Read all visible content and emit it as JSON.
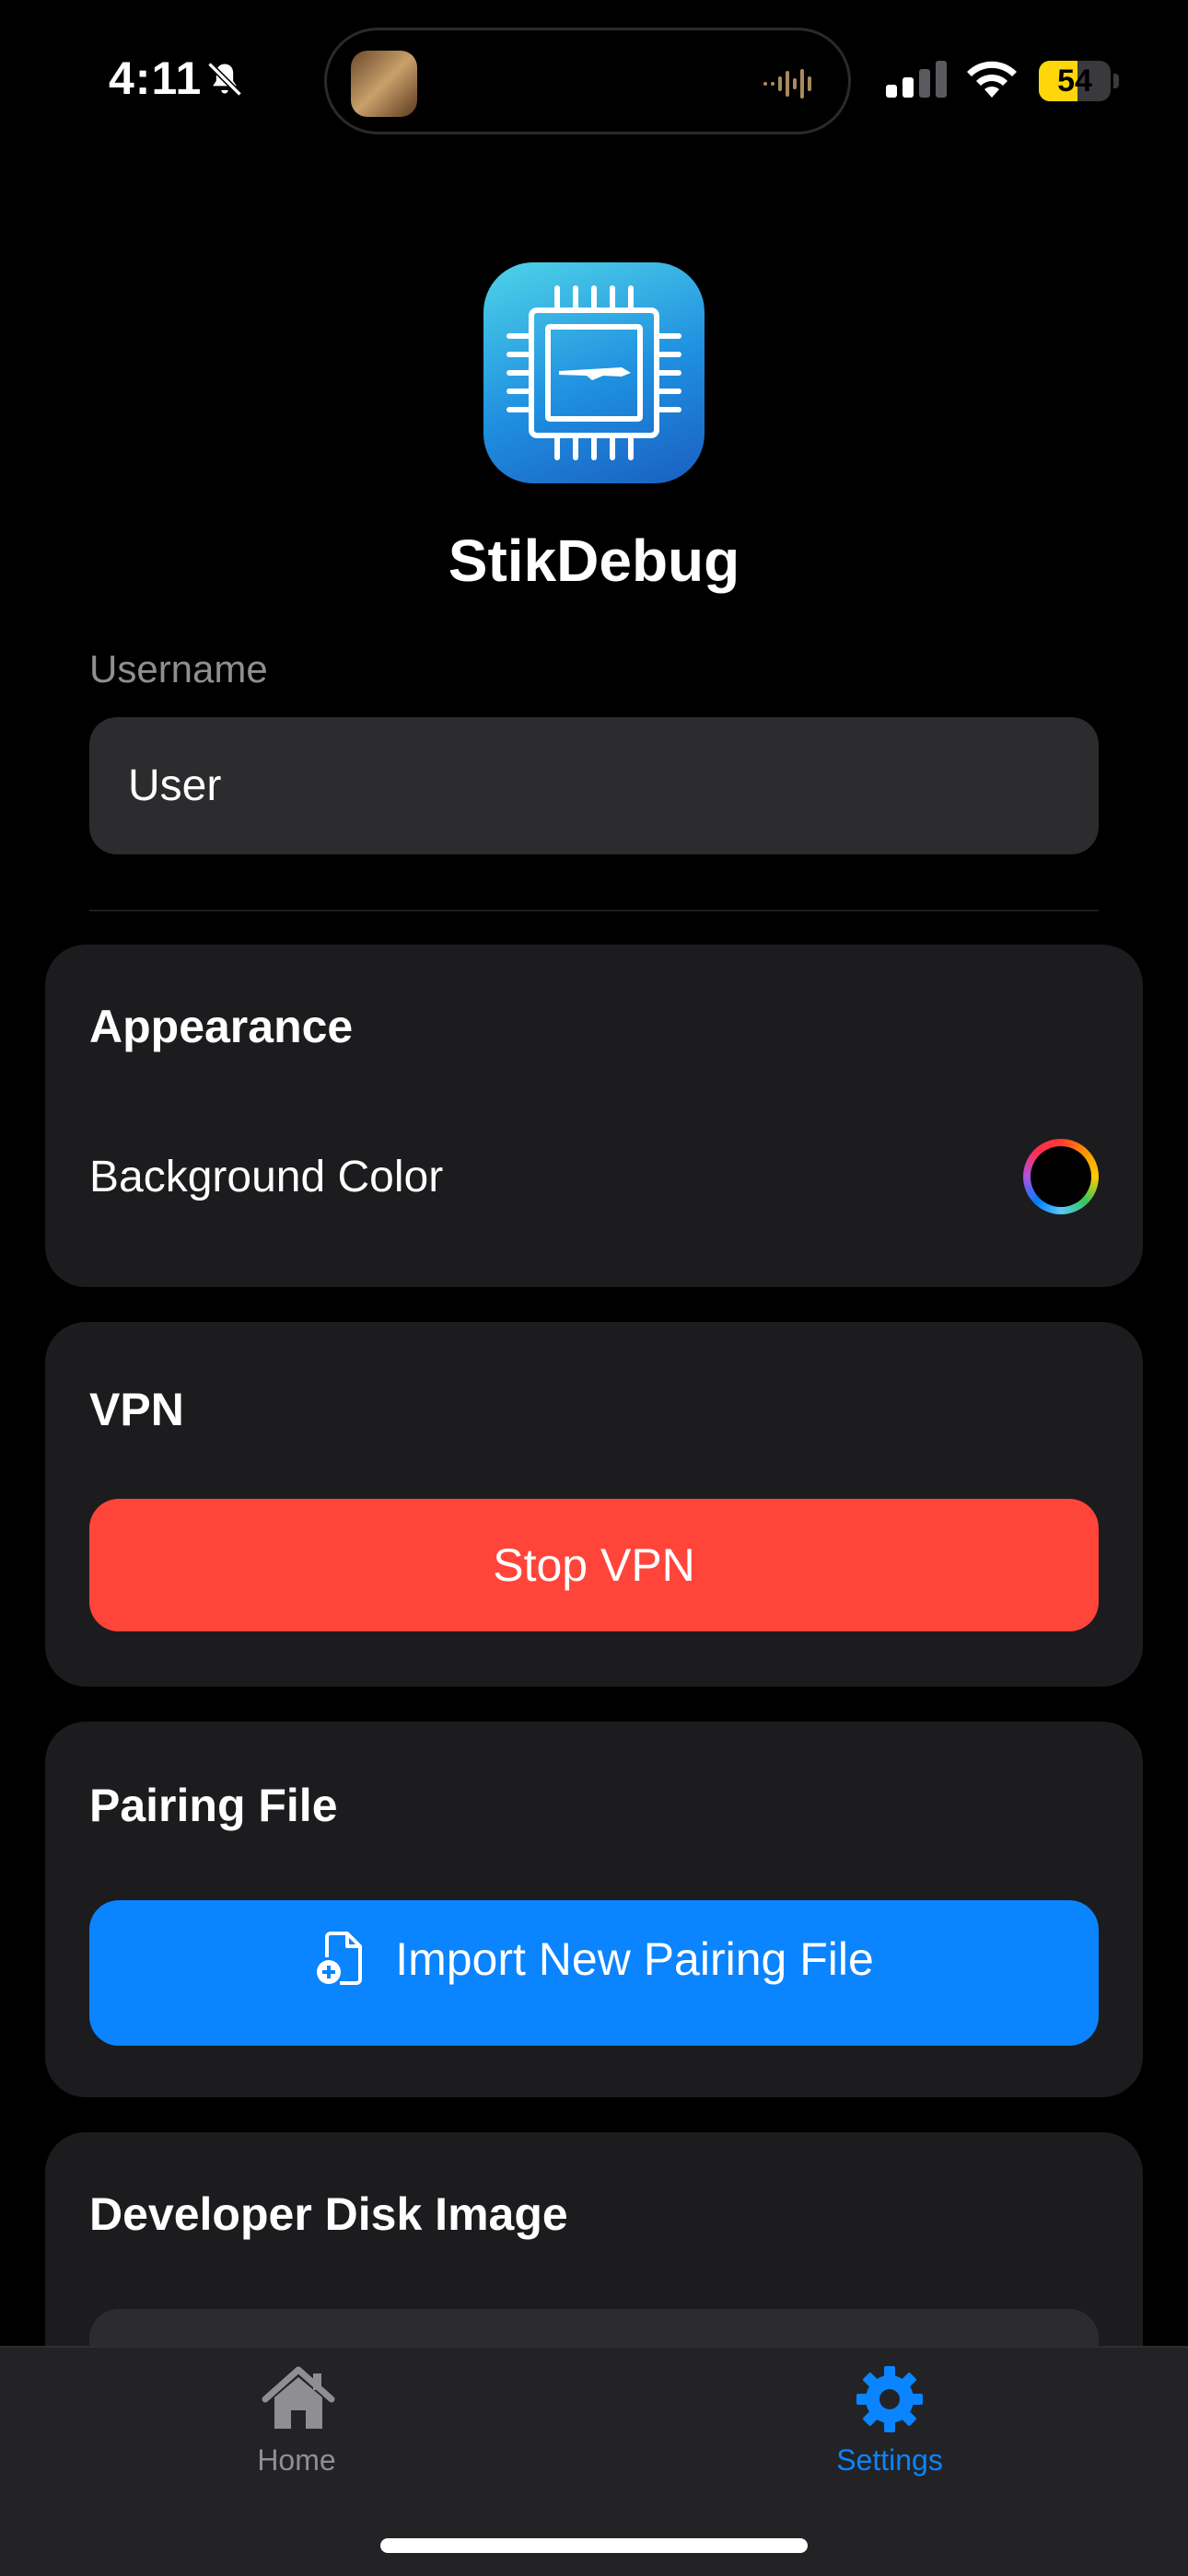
{
  "status_bar": {
    "time": "4:11",
    "battery_percent": "54",
    "battery_level": 0.54,
    "battery_color": "#ffd60a"
  },
  "app": {
    "name": "StikDebug",
    "icon": "chip-icon"
  },
  "username": {
    "label": "Username",
    "value": "User"
  },
  "appearance": {
    "title": "Appearance",
    "background_color_label": "Background Color",
    "color_well_icon": "color-picker-icon"
  },
  "vpn": {
    "title": "VPN",
    "button_label": "Stop VPN",
    "button_color": "#ff453a"
  },
  "pairing": {
    "title": "Pairing File",
    "button_label": "Import New Pairing File",
    "button_icon": "document-add-icon",
    "button_color": "#0a84ff"
  },
  "ddi": {
    "title": "Developer Disk Image"
  },
  "tabbar": {
    "tabs": [
      {
        "label": "Home",
        "icon": "house-icon",
        "selected": false
      },
      {
        "label": "Settings",
        "icon": "gear-icon",
        "selected": true
      }
    ],
    "accent": "#0a84ff"
  }
}
